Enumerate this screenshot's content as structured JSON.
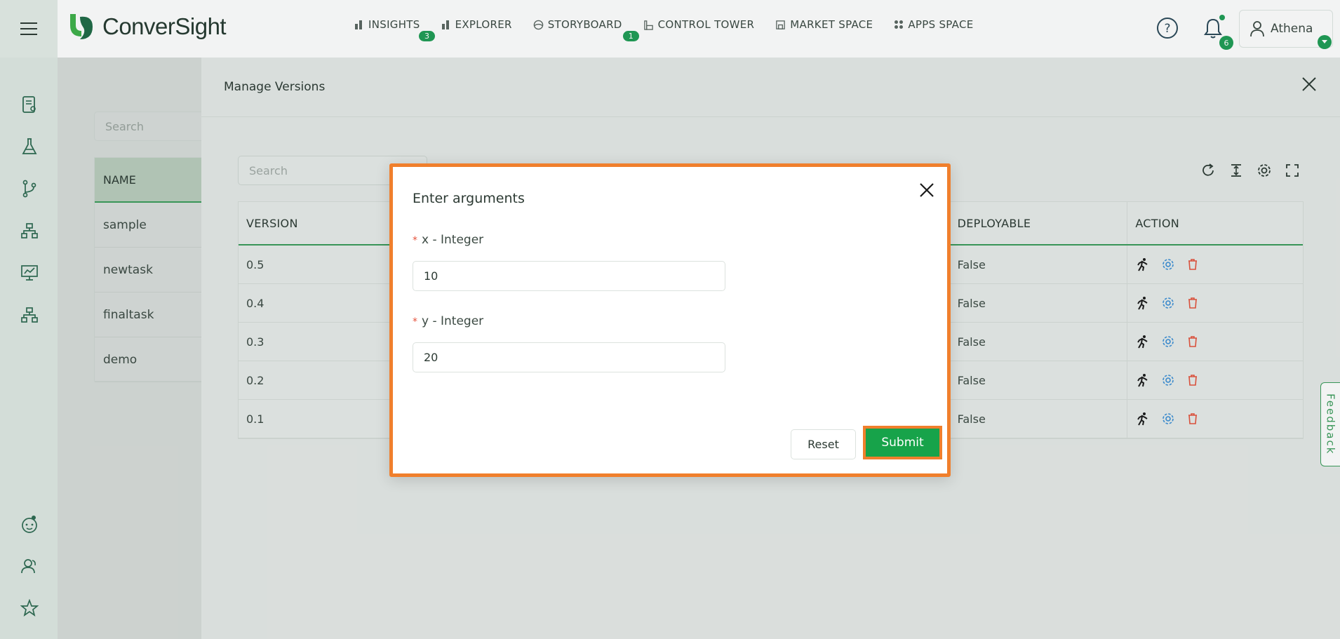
{
  "app": {
    "logo_text": "ConverSight"
  },
  "nav": [
    {
      "label": "INSIGHTS",
      "icon": "bar-chart-icon",
      "badge": "3"
    },
    {
      "label": "EXPLORER",
      "icon": "bar-chart-icon",
      "badge": ""
    },
    {
      "label": "STORYBOARD",
      "icon": "globe-icon",
      "badge": "1"
    },
    {
      "label": "CONTROL TOWER",
      "icon": "tower-icon",
      "badge": ""
    },
    {
      "label": "MARKET SPACE",
      "icon": "store-icon",
      "badge": ""
    },
    {
      "label": "APPS SPACE",
      "icon": "grid-icon",
      "badge": ""
    }
  ],
  "header": {
    "notification_count": "6",
    "user_name": "Athena"
  },
  "background": {
    "search_placeholder": "Search",
    "table_header": "NAME",
    "rows": [
      "sample",
      "newtask",
      "finaltask",
      "demo"
    ]
  },
  "drawer": {
    "title": "Manage Versions",
    "search_placeholder": "Search",
    "columns": {
      "version": "VERSION",
      "deployable": "DEPLOYABLE",
      "action": "ACTION"
    },
    "rows": [
      {
        "version": "0.5",
        "deployable": "False"
      },
      {
        "version": "0.4",
        "deployable": "False"
      },
      {
        "version": "0.3",
        "deployable": "False"
      },
      {
        "version": "0.2",
        "deployable": "False"
      },
      {
        "version": "0.1",
        "deployable": "False"
      }
    ]
  },
  "feedback_label": "Feedback",
  "modal": {
    "title": "Enter arguments",
    "required_mark": "*",
    "field_x": {
      "label": "x - Integer",
      "value": "10"
    },
    "field_y": {
      "label": "y - Integer",
      "value": "20"
    },
    "reset_label": "Reset",
    "submit_label": "Submit"
  },
  "colors": {
    "accent": "#17a34a",
    "highlight": "#f07f2c",
    "danger": "#e5533d",
    "info": "#3b8fd6"
  }
}
